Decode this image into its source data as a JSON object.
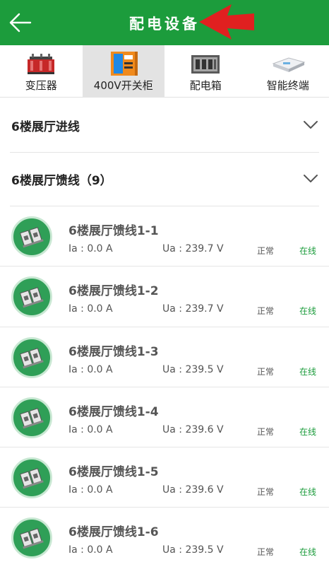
{
  "header": {
    "title": "配电设备"
  },
  "tabs": [
    {
      "label": "变压器",
      "icon": "transformer-icon",
      "active": false
    },
    {
      "label": "400V开关柜",
      "icon": "switchgear-icon",
      "active": true
    },
    {
      "label": "配电箱",
      "icon": "distribution-box-icon",
      "active": false
    },
    {
      "label": "智能终端",
      "icon": "smart-terminal-icon",
      "active": false
    }
  ],
  "sections": [
    {
      "title": "6楼展厅进线"
    },
    {
      "title": "6楼展厅馈线（9）"
    }
  ],
  "rows": [
    {
      "name": "6楼展厅馈线1-1",
      "ia": "Ia : 0.0 A",
      "ua": "Ua : 239.7 V",
      "status": "正常",
      "online": "在线"
    },
    {
      "name": "6楼展厅馈线1-2",
      "ia": "Ia : 0.0 A",
      "ua": "Ua : 239.7 V",
      "status": "正常",
      "online": "在线"
    },
    {
      "name": "6楼展厅馈线1-3",
      "ia": "Ia : 0.0 A",
      "ua": "Ua : 239.5 V",
      "status": "正常",
      "online": "在线"
    },
    {
      "name": "6楼展厅馈线1-4",
      "ia": "Ia : 0.0 A",
      "ua": "Ua : 239.6 V",
      "status": "正常",
      "online": "在线"
    },
    {
      "name": "6楼展厅馈线1-5",
      "ia": "Ia : 0.0 A",
      "ua": "Ua : 239.6 V",
      "status": "正常",
      "online": "在线"
    },
    {
      "name": "6楼展厅馈线1-6",
      "ia": "Ia : 0.0 A",
      "ua": "Ua : 239.5 V",
      "status": "正常",
      "online": "在线"
    }
  ],
  "colors": {
    "primary": "#1c9c3c",
    "annotation_arrow": "#e02020",
    "tab_active_bg": "#e3e3e3"
  }
}
